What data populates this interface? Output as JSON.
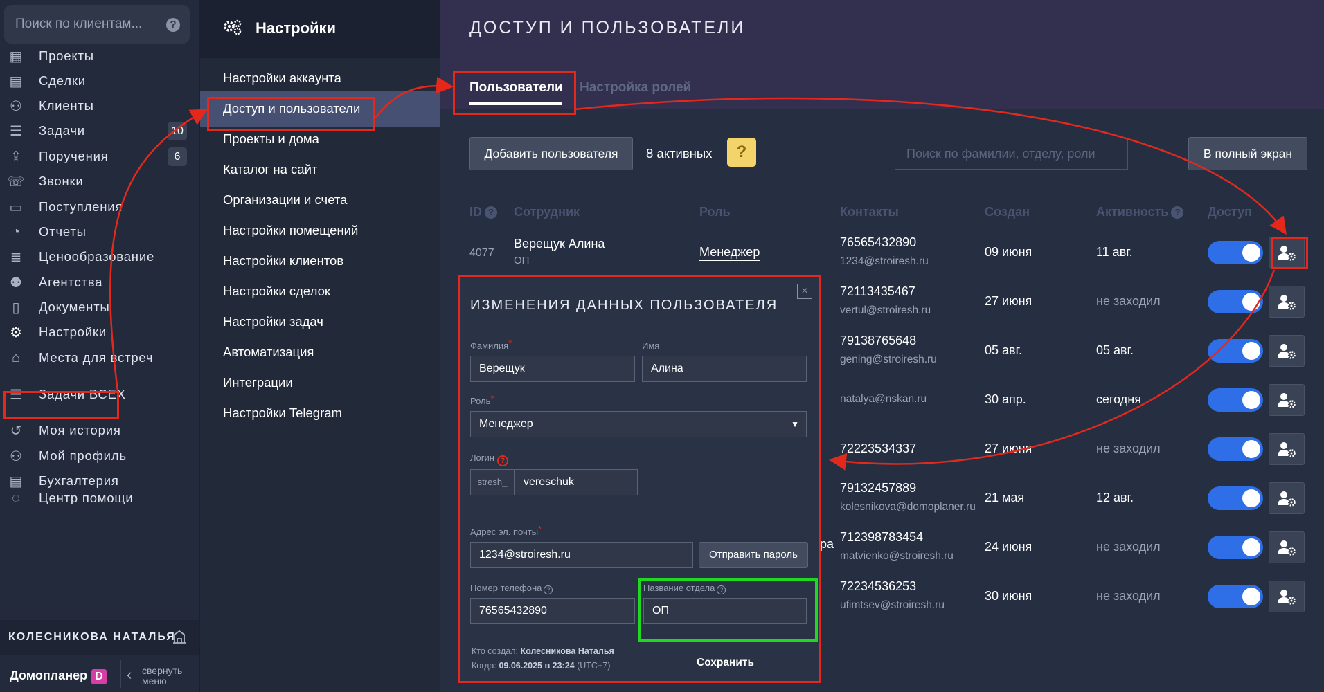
{
  "search": {
    "placeholder": "Поиск по клиентам..."
  },
  "leftnav": {
    "items": [
      {
        "label": "Проекты",
        "icon": "building-icon"
      },
      {
        "label": "Сделки",
        "icon": "deals-icon"
      },
      {
        "label": "Клиенты",
        "icon": "clients-icon"
      },
      {
        "label": "Задачи",
        "icon": "tasks-icon",
        "badge": "10"
      },
      {
        "label": "Поручения",
        "icon": "assignments-icon",
        "badge": "6"
      },
      {
        "label": "Звонки",
        "icon": "calls-icon"
      },
      {
        "label": "Поступления",
        "icon": "wallet-icon"
      },
      {
        "label": "Отчеты",
        "icon": "reports-icon"
      },
      {
        "label": "Ценообразование",
        "icon": "pricing-icon"
      },
      {
        "label": "Агентства",
        "icon": "agency-icon"
      },
      {
        "label": "Документы",
        "icon": "documents-icon"
      },
      {
        "label": "Настройки",
        "icon": "gear-icon"
      },
      {
        "label": "Места для встреч",
        "icon": "meeting-place-icon"
      },
      {
        "label": "Задачи ВСЕХ",
        "icon": "all-tasks-icon"
      },
      {
        "label": "Моя история",
        "icon": "history-icon"
      },
      {
        "label": "Мой профиль",
        "icon": "profile-icon"
      },
      {
        "label": "Бухгалтерия",
        "icon": "accounting-icon"
      },
      {
        "label": "Центр помощи",
        "icon": "help-center-icon"
      }
    ],
    "user_name": "КОЛЕСНИКОВА НАТАЛЬЯ",
    "brand": "Домопланер",
    "brand_letter": "D",
    "collapse_label": "свернуть меню"
  },
  "settings": {
    "title": "Настройки",
    "items": [
      "Настройки аккаунта",
      "Доступ и пользователи",
      "Проекты и дома",
      "Каталог на сайт",
      "Организации и счета",
      "Настройки помещений",
      "Настройки клиентов",
      "Настройки сделок",
      "Настройки задач",
      "Автоматизация",
      "Интеграции",
      "Настройки Telegram"
    ]
  },
  "main": {
    "title": "ДОСТУП И ПОЛЬЗОВАТЕЛИ",
    "tabs": [
      "Пользователи",
      "Настройка ролей"
    ],
    "add_user": "Добавить пользователя",
    "active_count": "8 активных",
    "search_placeholder": "Поиск по фамилии, отделу, роли",
    "fullscreen": "В полный экран",
    "columns": [
      "ID",
      "Сотрудник",
      "Роль",
      "Контакты",
      "Создан",
      "Активность",
      "Доступ"
    ],
    "rows": [
      {
        "id": "4077",
        "name": "Верещук Алина",
        "dept": "ОП",
        "role": "Менеджер",
        "phone": "76565432890",
        "email": "1234@stroiresh.ru",
        "created": "09 июня",
        "activity": "11 авг."
      },
      {
        "id": "",
        "name": "",
        "dept": "",
        "role": "",
        "phone": "72113435467",
        "email": "vertul@stroiresh.ru",
        "created": "27 июня",
        "activity": "не заходил"
      },
      {
        "id": "",
        "name": "",
        "dept": "",
        "role": "",
        "phone": "79138765648",
        "email": "gening@stroiresh.ru",
        "created": "05 авг.",
        "activity": "05 авг."
      },
      {
        "id": "",
        "name": "",
        "dept": "",
        "role": "",
        "phone": "",
        "email": "natalya@nskan.ru",
        "created": "30 апр.",
        "activity": "сегодня"
      },
      {
        "id": "",
        "name": "",
        "dept": "",
        "role": "",
        "phone": "72223534337",
        "email": "",
        "created": "27 июня",
        "activity": "не заходил"
      },
      {
        "id": "",
        "name": "",
        "dept": "",
        "role": "",
        "phone": "79132457889",
        "email": "kolesnikova@domoplaner.ru",
        "created": "21 мая",
        "activity": "12 авг."
      },
      {
        "id": "",
        "name": "",
        "dept": "",
        "role": "",
        "phone": "712398783454",
        "email": "matvienko@stroiresh.ru",
        "created": "24 июня",
        "activity": "не заходил"
      },
      {
        "id": "",
        "name": "",
        "dept": "",
        "role": "",
        "phone": "72234536253",
        "email": "ufimtsev@stroiresh.ru",
        "created": "30 июня",
        "activity": "не заходил"
      }
    ],
    "partial_text": "ра"
  },
  "modal": {
    "title": "ИЗМЕНЕНИЯ ДАННЫХ ПОЛЬЗОВАТЕЛЯ",
    "close": "×",
    "last_name_label": "Фамилия",
    "last_name": "Верещук",
    "first_name_label": "Имя",
    "first_name": "Алина",
    "role_label": "Роль",
    "role": "Менеджер",
    "login_label": "Логин",
    "login_prefix": "stresh_",
    "login": "vereschuk",
    "email_label": "Адрес эл. почты",
    "email": "1234@stroiresh.ru",
    "send_password": "Отправить пароль",
    "phone_label": "Номер телефона",
    "phone": "76565432890",
    "dept_label": "Название отдела",
    "dept": "ОП",
    "created_by_label": "Кто создал:",
    "created_by": "Колесникова Наталья",
    "created_when_label": "Когда:",
    "created_when": "09.06.2025 в 23:24",
    "timezone": "(UTC+7)",
    "save": "Сохранить"
  },
  "colors": {
    "annotation_red": "#e4291c",
    "annotation_green": "#1fd81f",
    "toggle_blue": "#2e6fe8",
    "help_yellow": "#f3d46a"
  }
}
